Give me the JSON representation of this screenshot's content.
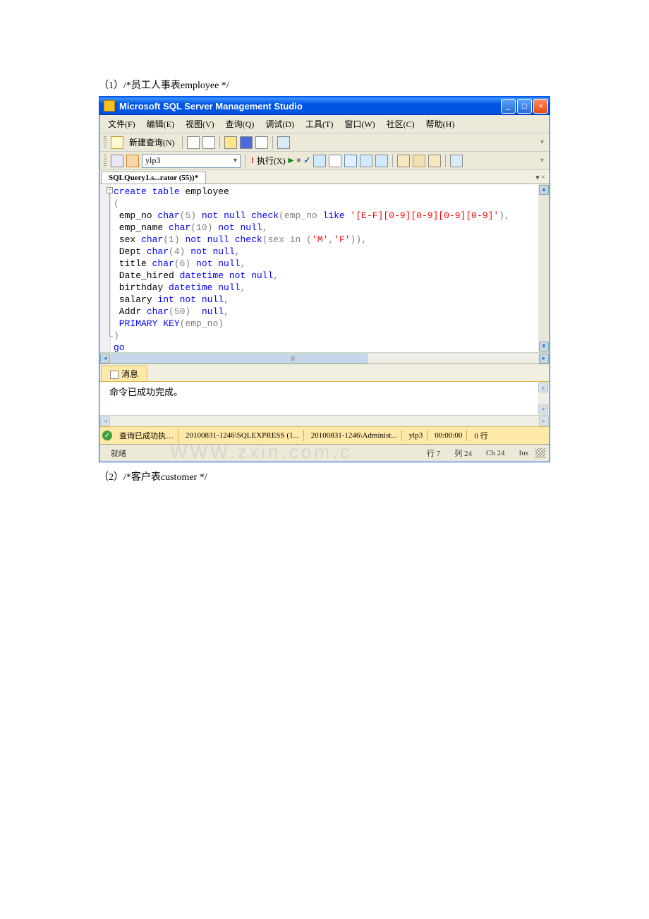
{
  "doc": {
    "line1": "（1）/*员工人事表employee */",
    "line2": "（2）/*客户表customer */"
  },
  "window": {
    "title": "Microsoft SQL Server Management Studio",
    "winbtn_min": "_",
    "winbtn_max": "□",
    "winbtn_close": "×"
  },
  "menu": {
    "file": "文件(F)",
    "edit": "编辑(E)",
    "view": "视图(V)",
    "query": "查询(Q)",
    "debug": "调试(D)",
    "tools": "工具(T)",
    "window": "窗口(W)",
    "community": "社区(C)",
    "help": "帮助(H)"
  },
  "toolbar1": {
    "new_query": "新建查询(N)"
  },
  "toolbar2": {
    "db": "ylp3",
    "execute": "执行(X)",
    "bang": "!"
  },
  "tab": {
    "name": "SQLQuery1.s...rator (55))*",
    "dropdown": "▾",
    "close": "×"
  },
  "code": {
    "l1_kw1": "create",
    "l1_kw2": "table",
    "l1_id": " employee",
    "l2": "(",
    "l3_a": " emp_no ",
    "l3_kw1": "char",
    "l3_b": "(5)",
    "l3_kw2": " not",
    "l3_kw3": " null",
    "l3_kw4": " check",
    "l3_c": "(emp_no ",
    "l3_kw5": "like",
    "l3_str": " '[E-F][0-9][0-9][0-9][0-9]'",
    "l3_d": "),",
    "l4_a": " emp_name ",
    "l4_kw1": "char",
    "l4_b": "(10)",
    "l4_kw2": " not",
    "l4_kw3": " null",
    "l4_c": ",",
    "l5_a": " sex ",
    "l5_kw1": "char",
    "l5_b": "(1)",
    "l5_kw2": " not",
    "l5_kw3": " null",
    "l5_kw4": " check",
    "l5_c": "(sex ",
    "l5_kw5": "in",
    "l5_d": " (",
    "l5_s1": "'M'",
    "l5_e": ",",
    "l5_s2": "'F'",
    "l5_f": ")),",
    "l6_a": " Dept ",
    "l6_kw1": "char",
    "l6_b": "(4)",
    "l6_kw2": " not",
    "l6_kw3": " null",
    "l6_c": ",",
    "l7_a": " title ",
    "l7_kw1": "char",
    "l7_b": "(6)",
    "l7_kw2": " not",
    "l7_kw3": " null",
    "l7_c": ",",
    "l8_a": " Date_hired ",
    "l8_kw1": "datetime",
    "l8_kw2": " not",
    "l8_kw3": " null",
    "l8_c": ",",
    "l9_a": " birthday ",
    "l9_kw1": "datetime",
    "l9_kw2": " null",
    "l9_c": ",",
    "l10_a": " salary ",
    "l10_kw1": "int",
    "l10_kw2": " not",
    "l10_kw3": " null",
    "l10_c": ",",
    "l11_a": " Addr ",
    "l11_kw1": "char",
    "l11_b": "(50)",
    "l11_kw2": "  null",
    "l11_c": ",",
    "l12_kw1": " PRIMARY",
    "l12_kw2": " KEY",
    "l12_a": "(emp_no)",
    "l13": ")",
    "l14": "go"
  },
  "messages": {
    "tab": "消息",
    "text": "命令已成功完成。"
  },
  "status1": {
    "ok": "✓",
    "query": "查询已成功执…",
    "server": "20100831-1246\\SQLEXPRESS (1...",
    "user": "20100831-1246\\Administ...",
    "db": "ylp3",
    "time": "00:00:00",
    "rows": "0 行"
  },
  "status2": {
    "ready": "就绪",
    "line": "行 7",
    "col": "列 24",
    "ch": "Ch 24",
    "ins": "Ins"
  },
  "watermark": "WWW.zxin.com.c"
}
